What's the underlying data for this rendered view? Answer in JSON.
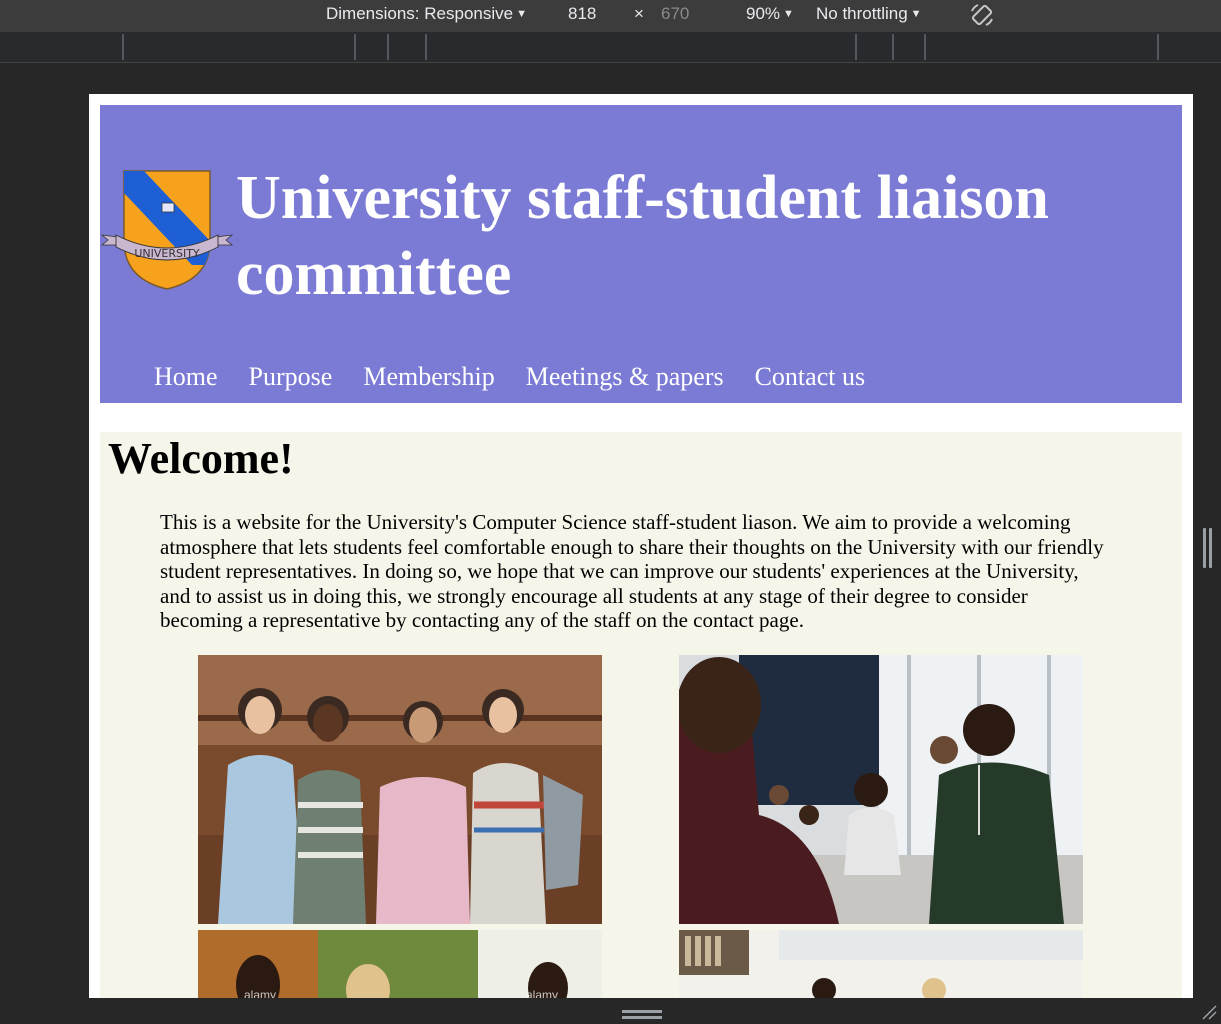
{
  "devtools": {
    "dimensions_label": "Dimensions: Responsive",
    "width_value": "818",
    "times_symbol": "×",
    "height_value": "670",
    "zoom": "90%",
    "throttling": "No throttling",
    "rotate_icon": "rotate-icon"
  },
  "site": {
    "title": "University staff-student liaison committee",
    "logo_text": "UNIVERSITY",
    "nav": [
      "Home",
      "Purpose",
      "Membership",
      "Meetings & papers",
      "Contact us"
    ],
    "welcome_heading": "Welcome!",
    "intro": "This is a website for the University's Computer Science staff-student liason. We aim to provide a welcoming atmosphere that lets students feel comfortable enough to share their thoughts on the University with our friendly student representatives. In doing so, we hope that we can improve our students' experiences at the University, and to assist us in doing this, we strongly encourage all students at any stage of their degree to consider becoming a representative by contacting any of the staff on the contact page.",
    "watermarks": [
      "alamy",
      "alamy"
    ]
  },
  "colors": {
    "header_bg": "#7b7bd5",
    "main_bg": "#f6f5ea",
    "shield_orange": "#f7a21c",
    "shield_blue": "#1f5fd6"
  }
}
